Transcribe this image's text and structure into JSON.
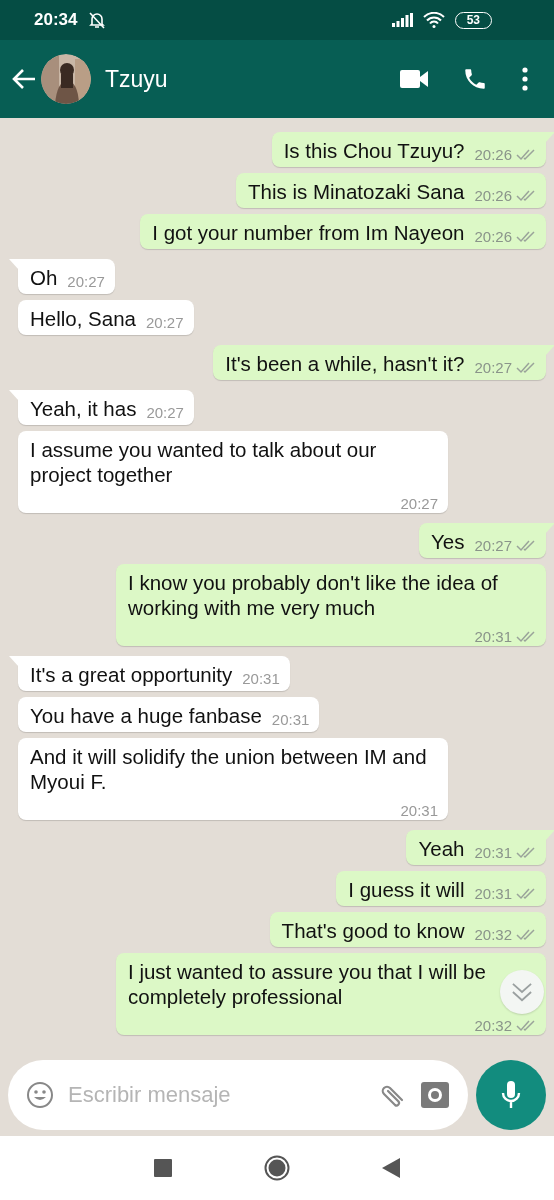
{
  "status_bar": {
    "time": "20:34",
    "battery": "53"
  },
  "header": {
    "contact": "Tzuyu"
  },
  "messages": [
    {
      "kind": "sent",
      "text": "Is this Chou Tzuyu?",
      "time": "20:26",
      "read": false
    },
    {
      "kind": "sent",
      "text": "This is Minatozaki Sana",
      "time": "20:26",
      "read": false
    },
    {
      "kind": "sent",
      "text": "I got your number from Im Nayeon",
      "time": "20:26",
      "read": false
    },
    {
      "kind": "received",
      "text": "Oh",
      "time": "20:27"
    },
    {
      "kind": "received",
      "text": "Hello, Sana",
      "time": "20:27"
    },
    {
      "kind": "sent",
      "text": "It's been a while, hasn't it?",
      "time": "20:27",
      "read": false
    },
    {
      "kind": "received",
      "text": "Yeah, it has",
      "time": "20:27"
    },
    {
      "kind": "received",
      "text": "I assume you wanted to talk about our project together",
      "time": "20:27"
    },
    {
      "kind": "sent",
      "text": "Yes",
      "time": "20:27",
      "read": false
    },
    {
      "kind": "sent",
      "text": "I know you probably don't like the idea of working with me very much",
      "time": "20:31",
      "read": false
    },
    {
      "kind": "received",
      "text": "It's a great opportunity",
      "time": "20:31"
    },
    {
      "kind": "received",
      "text": "You have a huge fanbase",
      "time": "20:31"
    },
    {
      "kind": "received",
      "text": "And it will solidify the union between IM and Myoui F.",
      "time": "20:31"
    },
    {
      "kind": "sent",
      "text": "Yeah",
      "time": "20:31",
      "read": false
    },
    {
      "kind": "sent",
      "text": "I guess it will",
      "time": "20:31",
      "read": false
    },
    {
      "kind": "sent",
      "text": "That's good to know",
      "time": "20:32",
      "read": false
    },
    {
      "kind": "sent",
      "text": "I just wanted to assure you that I will be completely professional",
      "time": "20:32",
      "read": false
    }
  ],
  "composer": {
    "placeholder": "Escribir mensaje"
  }
}
